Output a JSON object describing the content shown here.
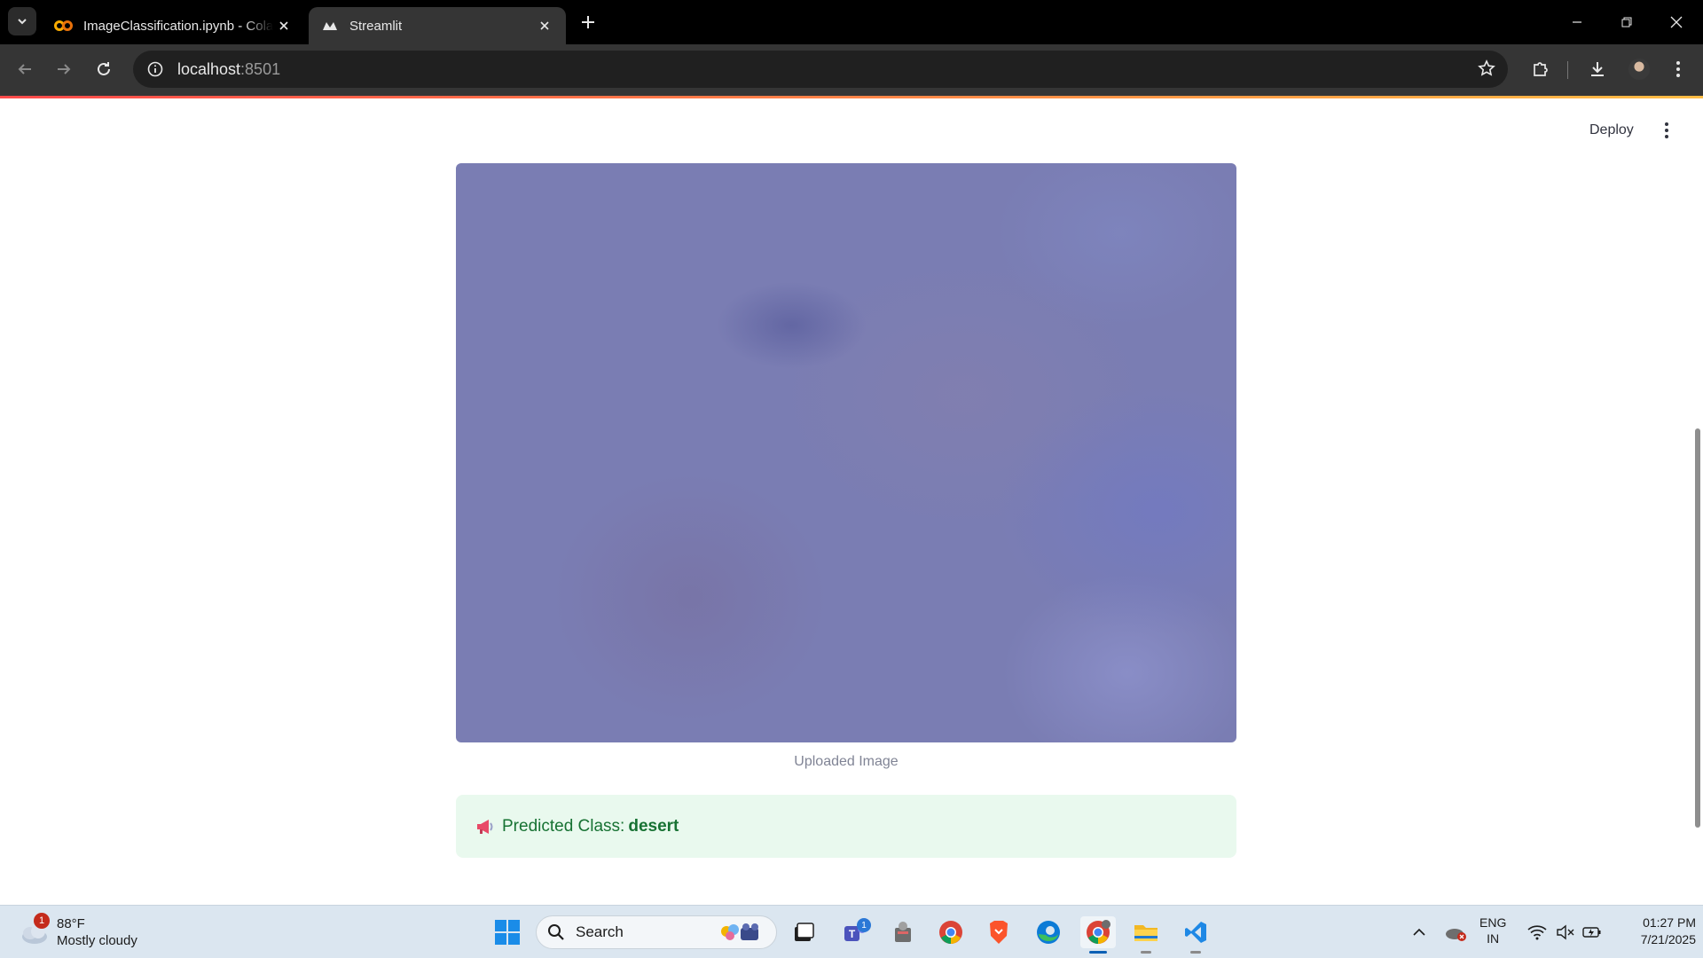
{
  "browser": {
    "tabs": [
      {
        "title": "ImageClassification.ipynb - Colab",
        "active": false
      },
      {
        "title": "Streamlit",
        "active": true
      }
    ],
    "url_host": "localhost",
    "url_port": ":8501"
  },
  "app": {
    "deploy_label": "Deploy",
    "image_caption": "Uploaded Image",
    "prediction_label": "Predicted Class:",
    "prediction_value": "desert",
    "accent_colors": {
      "success_bg": "#e9f9ee",
      "success_text": "#177233",
      "decoration": "#ff4b4b"
    }
  },
  "taskbar": {
    "weather": {
      "temp": "88°F",
      "condition": "Mostly cloudy",
      "badge": "1"
    },
    "search_placeholder": "Search",
    "teams_badge": "1",
    "lang_top": "ENG",
    "lang_bottom": "IN",
    "time": "01:27 PM",
    "date": "7/21/2025",
    "icons": [
      "windows-start-icon",
      "search-icon",
      "task-view-icon",
      "teams-icon",
      "app-icon",
      "chrome-icon",
      "brave-icon",
      "edge-icon",
      "chrome-profile-icon",
      "file-explorer-icon",
      "vscode-icon"
    ]
  }
}
